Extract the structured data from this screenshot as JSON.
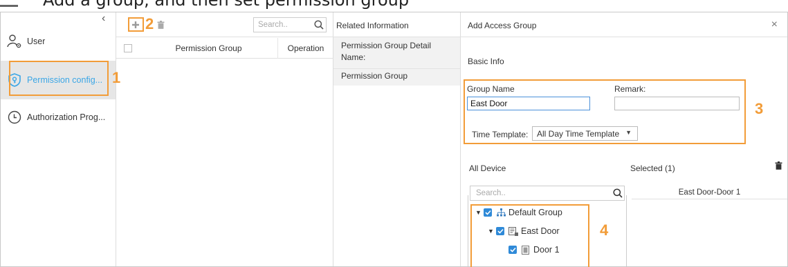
{
  "caption": "Add a group, and then set permission group",
  "nav": {
    "collapse_glyph": "‹",
    "items": [
      {
        "label": "User",
        "icon": "user-settings-icon"
      },
      {
        "label": "Permission config...",
        "icon": "shield-key-icon"
      },
      {
        "label": "Authorization Prog...",
        "icon": "clock-icon"
      }
    ]
  },
  "permission_list": {
    "search_placeholder": "Search..",
    "columns": [
      "Permission Group",
      "Operation"
    ]
  },
  "related": {
    "header": "Related Information",
    "section_line1": "Permission Group Detail",
    "section_line2": "Name:",
    "item": "Permission Group"
  },
  "add_group": {
    "title": "Add Access Group",
    "close_glyph": "×",
    "basic_info": "Basic Info",
    "group_name_label": "Group Name",
    "group_name_value": "East Door",
    "remark_label": "Remark:",
    "remark_value": "",
    "time_template_label": "Time Template:",
    "time_template_value": "All Day Time Template",
    "all_device_label": "All Device",
    "selected_label": "Selected (1)",
    "device_search_placeholder": "Search..",
    "tree": [
      {
        "label": "Default Group",
        "checked": true,
        "expanded": true
      },
      {
        "label": "East Door",
        "checked": true,
        "expanded": true
      },
      {
        "label": "Door 1",
        "checked": true
      }
    ],
    "selected_items": [
      "East Door-Door 1"
    ]
  },
  "annotations": [
    "1",
    "2",
    "3",
    "4"
  ],
  "colors": {
    "accent": "#3aa6e6",
    "annotation": "#f29c38",
    "checkbox": "#2f8ad8",
    "active_bg": "#e6e6e6"
  }
}
